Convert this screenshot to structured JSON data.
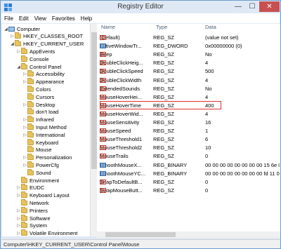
{
  "window": {
    "title": "Registry Editor",
    "min": "—",
    "max": "☐",
    "close": "✕"
  },
  "menu": [
    "File",
    "Edit",
    "View",
    "Favorites",
    "Help"
  ],
  "tree": [
    {
      "label": "Computer",
      "arrow": "◢",
      "kind": "pc",
      "indent": 0
    },
    {
      "label": "HKEY_CLASSES_ROOT",
      "arrow": "▷",
      "kind": "folder",
      "indent": 1
    },
    {
      "label": "HKEY_CURRENT_USER",
      "arrow": "◢",
      "kind": "folder",
      "indent": 1
    },
    {
      "label": "AppEvents",
      "arrow": "▷",
      "kind": "folder",
      "indent": 2
    },
    {
      "label": "Console",
      "arrow": "",
      "kind": "folder",
      "indent": 2
    },
    {
      "label": "Control Panel",
      "arrow": "◢",
      "kind": "folder",
      "indent": 2
    },
    {
      "label": "Accessibility",
      "arrow": "▷",
      "kind": "folder",
      "indent": 3
    },
    {
      "label": "Appearance",
      "arrow": "▷",
      "kind": "folder",
      "indent": 3
    },
    {
      "label": "Colors",
      "arrow": "",
      "kind": "folder",
      "indent": 3
    },
    {
      "label": "Cursors",
      "arrow": "",
      "kind": "folder",
      "indent": 3
    },
    {
      "label": "Desktop",
      "arrow": "▷",
      "kind": "folder",
      "indent": 3
    },
    {
      "label": "don't load",
      "arrow": "",
      "kind": "folder",
      "indent": 3
    },
    {
      "label": "Infrared",
      "arrow": "▷",
      "kind": "folder",
      "indent": 3
    },
    {
      "label": "Input Method",
      "arrow": "▷",
      "kind": "folder",
      "indent": 3
    },
    {
      "label": "International",
      "arrow": "▷",
      "kind": "folder",
      "indent": 3
    },
    {
      "label": "Keyboard",
      "arrow": "",
      "kind": "folder",
      "indent": 3
    },
    {
      "label": "Mouse",
      "arrow": "",
      "kind": "folder",
      "indent": 3
    },
    {
      "label": "Personalization",
      "arrow": "▷",
      "kind": "folder",
      "indent": 3
    },
    {
      "label": "PowerCfg",
      "arrow": "▷",
      "kind": "folder",
      "indent": 3
    },
    {
      "label": "Sound",
      "arrow": "",
      "kind": "folder",
      "indent": 3
    },
    {
      "label": "Environment",
      "arrow": "",
      "kind": "folder",
      "indent": 2
    },
    {
      "label": "EUDC",
      "arrow": "▷",
      "kind": "folder",
      "indent": 2
    },
    {
      "label": "Keyboard Layout",
      "arrow": "▷",
      "kind": "folder",
      "indent": 2
    },
    {
      "label": "Network",
      "arrow": "",
      "kind": "folder",
      "indent": 2
    },
    {
      "label": "Printers",
      "arrow": "▷",
      "kind": "folder",
      "indent": 2
    },
    {
      "label": "Software",
      "arrow": "▷",
      "kind": "folder",
      "indent": 2
    },
    {
      "label": "System",
      "arrow": "▷",
      "kind": "folder",
      "indent": 2
    },
    {
      "label": "Volatile Environment",
      "arrow": "▷",
      "kind": "folder",
      "indent": 2
    }
  ],
  "columns": {
    "name": "Name",
    "type": "Type",
    "data": "Data"
  },
  "values": [
    {
      "name": "(Default)",
      "type": "REG_SZ",
      "data": "(value not set)",
      "icon": "ab"
    },
    {
      "name": "ActiveWindowTr...",
      "type": "REG_DWORD",
      "data": "0x00000000 (0)",
      "icon": "bin"
    },
    {
      "name": "Beep",
      "type": "REG_SZ",
      "data": "No",
      "icon": "ab"
    },
    {
      "name": "DoubleClickHeig...",
      "type": "REG_SZ",
      "data": "4",
      "icon": "ab"
    },
    {
      "name": "DoubleClickSpeed",
      "type": "REG_SZ",
      "data": "500",
      "icon": "ab"
    },
    {
      "name": "DoubleClickWidth",
      "type": "REG_SZ",
      "data": "4",
      "icon": "ab"
    },
    {
      "name": "ExtendedSounds",
      "type": "REG_SZ",
      "data": "No",
      "icon": "ab"
    },
    {
      "name": "MouseHoverHei...",
      "type": "REG_SZ",
      "data": "4",
      "icon": "ab"
    },
    {
      "name": "MouseHoverTime",
      "type": "REG_SZ",
      "data": "400",
      "icon": "ab"
    },
    {
      "name": "MouseHoverWid...",
      "type": "REG_SZ",
      "data": "4",
      "icon": "ab"
    },
    {
      "name": "MouseSensitivity",
      "type": "REG_SZ",
      "data": "16",
      "icon": "ab"
    },
    {
      "name": "MouseSpeed",
      "type": "REG_SZ",
      "data": "1",
      "icon": "ab"
    },
    {
      "name": "MouseThreshold1",
      "type": "REG_SZ",
      "data": "6",
      "icon": "ab"
    },
    {
      "name": "MouseThreshold2",
      "type": "REG_SZ",
      "data": "10",
      "icon": "ab"
    },
    {
      "name": "MouseTrails",
      "type": "REG_SZ",
      "data": "0",
      "icon": "ab"
    },
    {
      "name": "SmoothMouseX...",
      "type": "REG_BINARY",
      "data": "00 00 00 00 00 00 00 00 15 6e 0",
      "icon": "bin"
    },
    {
      "name": "SmoothMouseYC...",
      "type": "REG_BINARY",
      "data": "00 00 00 00 00 00 00 00 fd 11 0",
      "icon": "bin"
    },
    {
      "name": "SnapToDefaultB...",
      "type": "REG_SZ",
      "data": "0",
      "icon": "ab"
    },
    {
      "name": "SwapMouseButt...",
      "type": "REG_SZ",
      "data": "0",
      "icon": "ab"
    }
  ],
  "highlighted_value": "MouseHoverTime",
  "status": "Computer\\HKEY_CURRENT_USER\\Control Panel\\Mouse",
  "colors": {
    "highlight_border": "#e0302a",
    "close_button": "#c75050",
    "window_border": "#6d9ecf"
  }
}
